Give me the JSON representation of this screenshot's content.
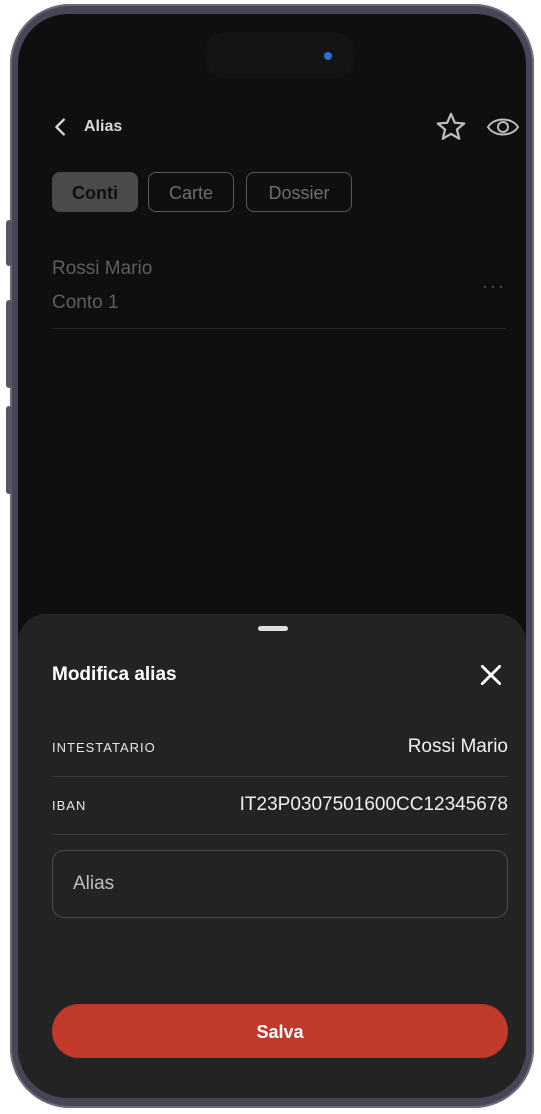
{
  "header": {
    "title": "Alias",
    "back_icon": "chevron-left-icon",
    "favorite_icon": "star-outline-icon",
    "visibility_icon": "eye-icon"
  },
  "tabs": [
    {
      "label": "Conti",
      "active": true
    },
    {
      "label": "Carte",
      "active": false
    },
    {
      "label": "Dossier",
      "active": false
    }
  ],
  "account": {
    "holder": "Rossi Mario",
    "name": "Conto 1",
    "more_icon": "more-horizontal-icon",
    "more_label": "···"
  },
  "sheet": {
    "title": "Modifica alias",
    "close_icon": "close-icon",
    "rows": [
      {
        "label": "INTESTATARIO",
        "value": "Rossi Mario"
      },
      {
        "label": "IBAN",
        "value": "IT23P0307501600CC12345678"
      }
    ],
    "alias_placeholder": "Alias",
    "save_label": "Salva"
  },
  "colors": {
    "accent": "#c0392b",
    "sheet_bg": "#232323",
    "screen_bg": "#0f0f10"
  }
}
